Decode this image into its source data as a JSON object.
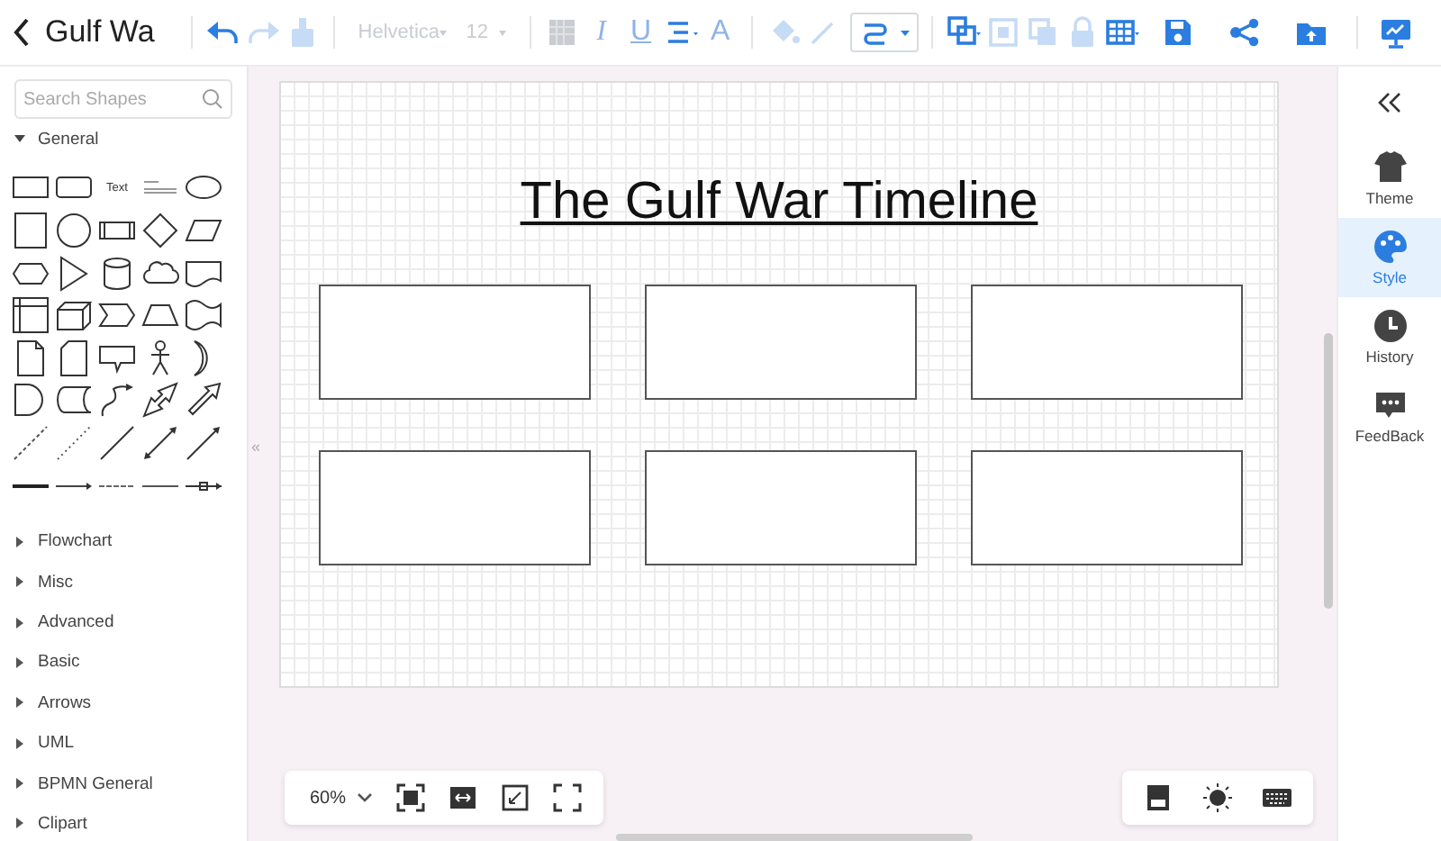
{
  "toolbar": {
    "title": "Gulf Wa",
    "left_tools": [
      {
        "kind": "undo",
        "disabled": false
      },
      {
        "kind": "redo",
        "disabled": true
      },
      {
        "kind": "format-painter",
        "disabled": true
      }
    ],
    "font": {
      "value": "Helvetica",
      "disabled": true
    },
    "font_size": {
      "value": "12",
      "disabled": true
    },
    "text_tools": [
      {
        "kind": "fill-block",
        "disabled": true
      },
      {
        "kind": "italic",
        "label": "I",
        "disabled": true
      },
      {
        "kind": "underline",
        "label": "U",
        "disabled": true
      },
      {
        "kind": "align",
        "disabled": false
      },
      {
        "kind": "text-color",
        "label": "A",
        "disabled": true
      }
    ],
    "style_tools": [
      {
        "kind": "bucket",
        "disabled": true
      },
      {
        "kind": "pen",
        "disabled": true
      },
      {
        "kind": "connector",
        "disabled": false
      }
    ],
    "arrange_tools": [
      {
        "kind": "arrange",
        "disabled": false
      },
      {
        "kind": "to-front",
        "disabled": true
      },
      {
        "kind": "to-back",
        "disabled": true
      },
      {
        "kind": "lock",
        "disabled": true
      },
      {
        "kind": "table",
        "disabled": false
      }
    ],
    "file_tools": [
      {
        "kind": "save",
        "disabled": false
      },
      {
        "kind": "share",
        "disabled": false
      },
      {
        "kind": "export",
        "disabled": false
      }
    ],
    "present_tool": {
      "kind": "present",
      "disabled": false
    }
  },
  "shape_panel": {
    "search": {
      "placeholder": "Search Shapes"
    },
    "text_shape": "Text",
    "categories": [
      {
        "label": "General",
        "expanded": true
      },
      {
        "label": "Flowchart",
        "expanded": false
      },
      {
        "label": "Misc",
        "expanded": false
      },
      {
        "label": "Advanced",
        "expanded": false
      },
      {
        "label": "Basic",
        "expanded": false
      },
      {
        "label": "Arrows",
        "expanded": false
      },
      {
        "label": "UML",
        "expanded": false
      },
      {
        "label": "BPMN General",
        "expanded": false
      },
      {
        "label": "Clipart",
        "expanded": false
      }
    ]
  },
  "splitter_glyph": "«",
  "canvas": {
    "title": "The Gulf War Timeline",
    "boxes": [
      {
        "kind": "rectangle"
      },
      {
        "kind": "rectangle"
      },
      {
        "kind": "rectangle"
      },
      {
        "kind": "rectangle"
      },
      {
        "kind": "rectangle"
      },
      {
        "kind": "rectangle"
      }
    ],
    "zoom": "60%"
  },
  "side_panel": {
    "items": [
      {
        "kind": "theme",
        "label": "Theme",
        "selected": false
      },
      {
        "kind": "style",
        "label": "Style",
        "selected": true
      },
      {
        "kind": "history",
        "label": "History",
        "selected": false
      },
      {
        "kind": "feedback",
        "label": "FeedBack",
        "selected": false
      }
    ]
  }
}
